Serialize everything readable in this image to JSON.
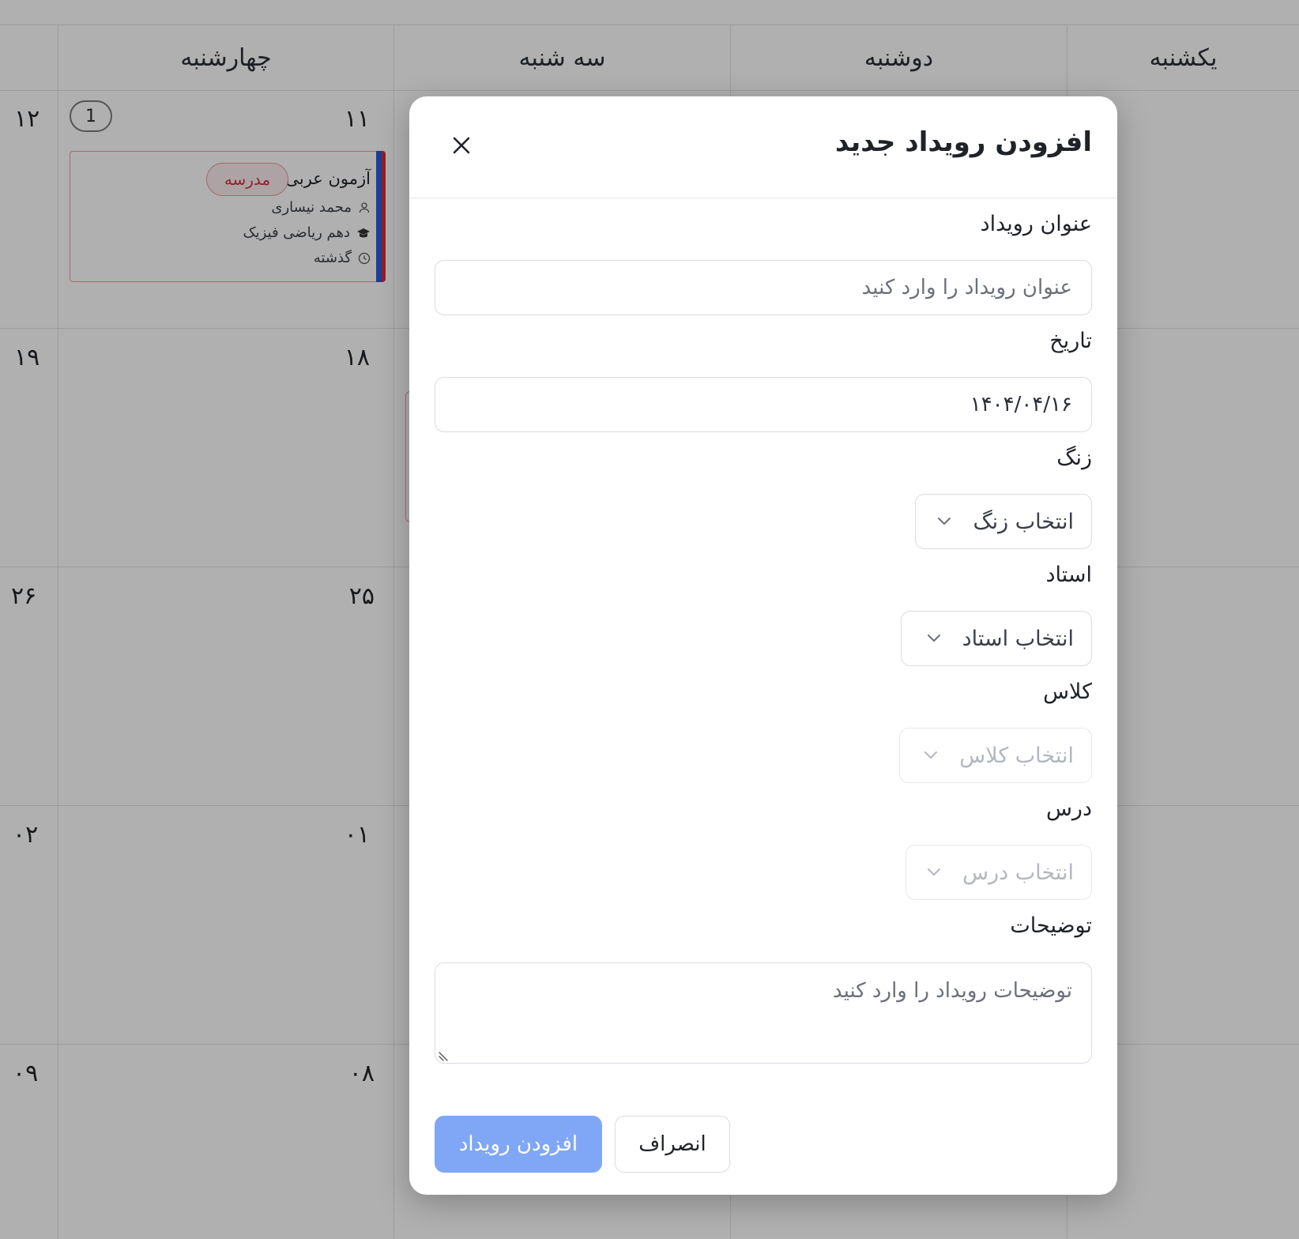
{
  "calendar": {
    "day_headers": [
      "یکشنبه",
      "دوشنبه",
      "سه شنبه",
      "چهارشنبه"
    ],
    "rows": [
      {
        "wed": "۱۱",
        "thu": "۱۲"
      },
      {
        "wed": "۱۸",
        "thu": "۱۹"
      },
      {
        "wed": "۲۵",
        "thu": "۲۶"
      },
      {
        "wed": "۰۱",
        "thu": "۰۲"
      },
      {
        "wed": "۰۸",
        "thu": "۰۹"
      }
    ],
    "event_count": "1",
    "event": {
      "title": "آزمون عربی",
      "tag": "مدرسه",
      "teacher": "محمد نیساری",
      "class": "دهم ریاضی فیزیک",
      "status": "گذشته",
      "stripe_colors": [
        "#2b5bd7",
        "#d92b2b"
      ]
    }
  },
  "modal": {
    "title": "افزودن رویداد جدید",
    "fields": {
      "event_title": {
        "label": "عنوان رویداد",
        "placeholder": "عنوان رویداد را وارد کنید",
        "value": ""
      },
      "date": {
        "label": "تاریخ",
        "value": "۱۴۰۴/۰۴/۱۶"
      },
      "bell": {
        "label": "زنگ",
        "placeholder": "انتخاب زنگ"
      },
      "teacher": {
        "label": "استاد",
        "placeholder": "انتخاب استاد"
      },
      "class": {
        "label": "کلاس",
        "placeholder": "انتخاب کلاس"
      },
      "lesson": {
        "label": "درس",
        "placeholder": "انتخاب درس"
      },
      "description": {
        "label": "توضیحات",
        "placeholder": "توضیحات رویداد را وارد کنید"
      }
    },
    "buttons": {
      "submit": "افزودن رویداد",
      "cancel": "انصراف"
    },
    "colors": {
      "primary_disabled": "#7fa7f5",
      "tag_red": "#d03040"
    }
  }
}
